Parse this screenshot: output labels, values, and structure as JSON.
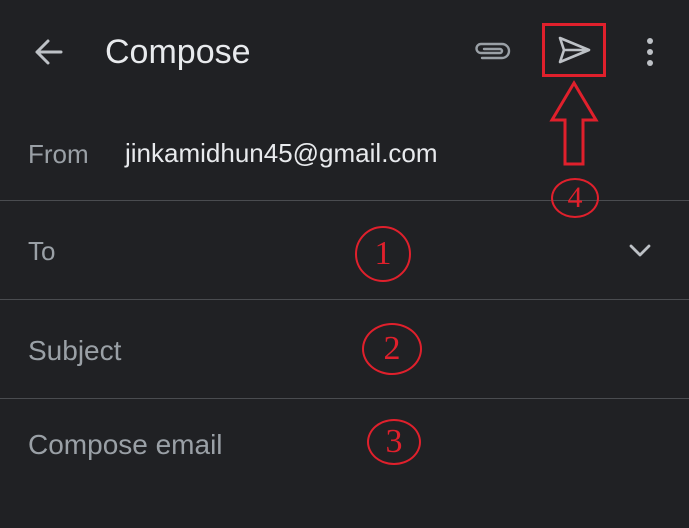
{
  "header": {
    "title": "Compose",
    "icons": {
      "back": "arrow-left",
      "attach": "paperclip",
      "send": "send-arrow",
      "more": "vertical-dots"
    }
  },
  "from": {
    "label": "From",
    "value": "jinkamidhun45@gmail.com"
  },
  "to": {
    "label": "To"
  },
  "subject": {
    "placeholder": "Subject"
  },
  "body": {
    "placeholder": "Compose email"
  },
  "annotations": {
    "step1": "1",
    "step2": "2",
    "step3": "3",
    "step4": "4"
  },
  "colors": {
    "background": "#202124",
    "text": "#e8eaed",
    "muted": "#9aa0a6",
    "divider": "#4a4c50",
    "annotation": "#e0202c"
  }
}
